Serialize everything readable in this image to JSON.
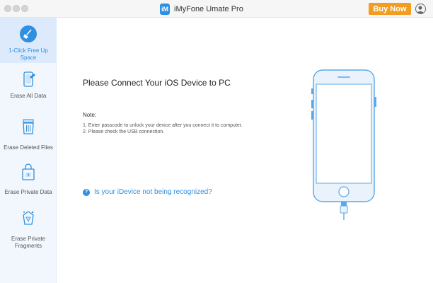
{
  "window": {
    "title": "iMyFone Umate Pro",
    "logo_letter": "iM",
    "buy_label": "Buy Now"
  },
  "colors": {
    "accent": "#2f8fe0",
    "buy": "#f39c1f",
    "sidebar_bg": "#f2f7fd",
    "sidebar_active": "#ddeafb"
  },
  "sidebar": {
    "items": [
      {
        "label": "1-Click Free Up Space",
        "icon": "broom-icon",
        "active": true
      },
      {
        "label": "Erase All Data",
        "icon": "phone-eraser-icon",
        "active": false
      },
      {
        "label": "Erase Deleted Files",
        "icon": "trash-files-icon",
        "active": false
      },
      {
        "label": "Erase Private Data",
        "icon": "lock-shield-icon",
        "active": false
      },
      {
        "label": "Erase Private Fragments",
        "icon": "fragment-eraser-icon",
        "active": false
      }
    ]
  },
  "main": {
    "title": "Please Connect Your iOS Device to PC",
    "note_label": "Note:",
    "note_line_1": "1. Enter passcode to unlock your device after you connect it to computer.",
    "note_line_2": "2. Please check the USB connection.",
    "help_icon_glyph": "?",
    "help_link": "Is your iDevice not being recognized?"
  }
}
